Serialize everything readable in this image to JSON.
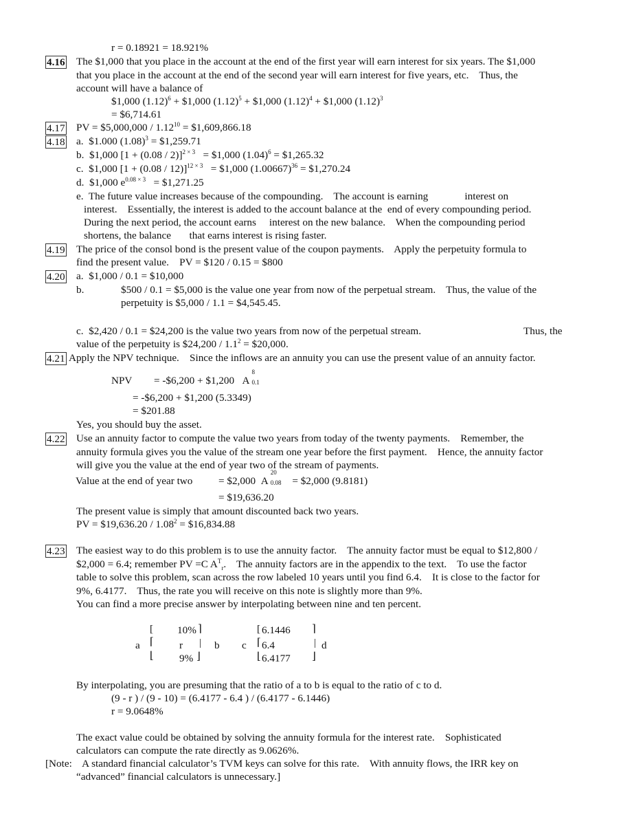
{
  "lines": {
    "l0": "r = 0.18921 = 18.921%",
    "p416_label": "4.16",
    "p416_1": "The $1,000 that you place in the account at the end of the first year will earn interest for six years. The $1,000",
    "p416_2": "that you place in the account at the end of the second year will earn interest for five years, etc.    Thus, the",
    "p416_3": "account will have a balance of",
    "p416_eq_a": "$1,000 (1.12)",
    "p416_eq_a_exp": "6",
    "p416_eq_b": " + $1,000 (1.12)",
    "p416_eq_b_exp": "5",
    "p416_eq_c": " + $1,000 (1.12)",
    "p416_eq_c_exp": "4",
    "p416_eq_d": " + $1,000 (1.12)",
    "p416_eq_d_exp": "3",
    "p416_result": "= $6,714.61",
    "p417_label": "4.17",
    "p417_a": "PV = $5,000,000 / 1.12",
    "p417_exp": "10",
    "p417_b": " = $1,609,866.18",
    "p418_label": "4.18",
    "p418_a1": "a.  $1.000 (1.08)",
    "p418_a_exp": "3",
    "p418_a2": " = $1,259.71",
    "p418_b1": "b.  $1,000 [1 + (0.08 / 2)]",
    "p418_b_exp": "2 × 3",
    "p418_b2": "   = $1,000 (1.04)",
    "p418_b_exp2": "6",
    "p418_b3": " = $1,265.32",
    "p418_c1": "c.  $1,000 [1 + (0.08 / 12)]",
    "p418_c_exp": "12 × 3",
    "p418_c2": "   = $1,000 (1.00667)",
    "p418_c_exp2": "36",
    "p418_c3": " = $1,270.24",
    "p418_d1": "d.  $1,000 e",
    "p418_d_exp": "0.08 × 3",
    "p418_d2": "   = $1,271.25",
    "p418_e1": "e.  The future value increases because of the compounding.    The account is earning              interest on",
    "p418_e2": "interest.    Essentially, the interest is added to the account balance at the  end of every compounding period.",
    "p418_e3": "During the next period, the account earns     interest on the new balance.    When the compounding period",
    "p418_e4": "shortens, the balance       that earns interest is rising faster.",
    "p419_label": "4.19",
    "p419_1": "The price of the consol bond is the present value of the coupon payments.    Apply the perpetuity formula to",
    "p419_2": "find the present value.    PV = $120 / 0.15 = $800",
    "p420_label": "4.20",
    "p420_a": "a.  $1,000 / 0.1 = $10,000",
    "p420_b_label": "b.",
    "p420_b1": "$500 / 0.1 = $5,000 is the value one year from now of the perpetual stream.    Thus, the value of the",
    "p420_b2": "perpetuity is $5,000 / 1.1 = $4,545.45.",
    "p420_c1": "c.  $2,420 / 0.1 = $24,200 is the value two years from now of the perpetual stream.",
    "p420_c1_tail": "Thus, the",
    "p420_c2a": "value of the perpetuity is $24,200 / 1.1",
    "p420_c2_exp": "2",
    "p420_c2b": " = $20,000.",
    "p421_label": "4.21",
    "p421_1": "Apply the NPV technique.    Since the inflows are an annuity you can use the present value of an annuity factor.",
    "p421_npv": "NPV",
    "p421_eq1": "= -$6,200 + $1,200",
    "p421_A": "A",
    "p421_A_sup": "8",
    "p421_A_sub": "0.1",
    "p421_eq2": "= -$6,200 + $1,200 (5.3349)",
    "p421_eq3": "= $201.88",
    "p421_yes": "Yes, you should buy the asset.",
    "p422_label": "4.22",
    "p422_1": "Use an annuity factor to compute the value two years from today of the twenty payments.    Remember, the",
    "p422_2": "annuity formula gives you the value of the stream one year before the first payment.    Hence, the annuity factor",
    "p422_3": "will give you the value at the end of year two of the stream of payments.",
    "p422_val_label": "Value at the end of year two",
    "p422_eq1": "= $2,000",
    "p422_A": "A",
    "p422_A_sup": "20",
    "p422_A_sub": "0.08",
    "p422_eq1b": "= $2,000 (9.8181)",
    "p422_eq2": "= $19,636.20",
    "p422_4": "The present value is simply that amount discounted back two years.",
    "p422_5a": "PV = $19,636.20 / 1.08",
    "p422_5_exp": "2",
    "p422_5b": " = $16,834.88",
    "p423_label": "4.23",
    "p423_1": "The easiest way to do this problem is to use the annuity factor.    The annuity factor must be equal to $12,800 /",
    "p423_2a": "$2,000 = 6.4; remember PV =C A",
    "p423_2_sup": "T",
    "p423_2_sub": "r",
    "p423_2b": ".    The annuity factors are in the appendix to the text.    To use the factor",
    "p423_3": "table to solve this problem, scan across the row labeled 10 years until you find 6.4.    It is close to the factor for",
    "p423_4": "9%, 6.4177.    Thus, the rate you will receive on this note is slightly more than 9%.",
    "p423_5": "You can find a more precise answer by interpolating between nine and ten percent.",
    "interp": {
      "a": "a",
      "b": "b",
      "c": "c",
      "d": "d",
      "left_top": "10%",
      "left_mid": "r",
      "left_bot": "9%",
      "right_top": "6.1446",
      "right_mid": "6.4",
      "right_bot": "6.4177"
    },
    "p423_6": "By interpolating, you are presuming that the ratio of a to b is equal to the ratio of c to d.",
    "p423_7": "(9 - r ) / (9 - 10) = (6.4177 - 6.4 ) / (6.4177 - 6.1446)",
    "p423_8": "r = 9.0648%",
    "p423_9": "The exact value could be obtained by solving the annuity formula for the interest rate.    Sophisticated",
    "p423_10": "calculators can compute the rate directly as 9.0626%.",
    "note_1": "[Note:    A standard financial calculator’s TVM keys can solve for this rate.    With annuity flows, the IRR key on",
    "note_2": "“advanced” financial calculators is unnecessary.]"
  }
}
